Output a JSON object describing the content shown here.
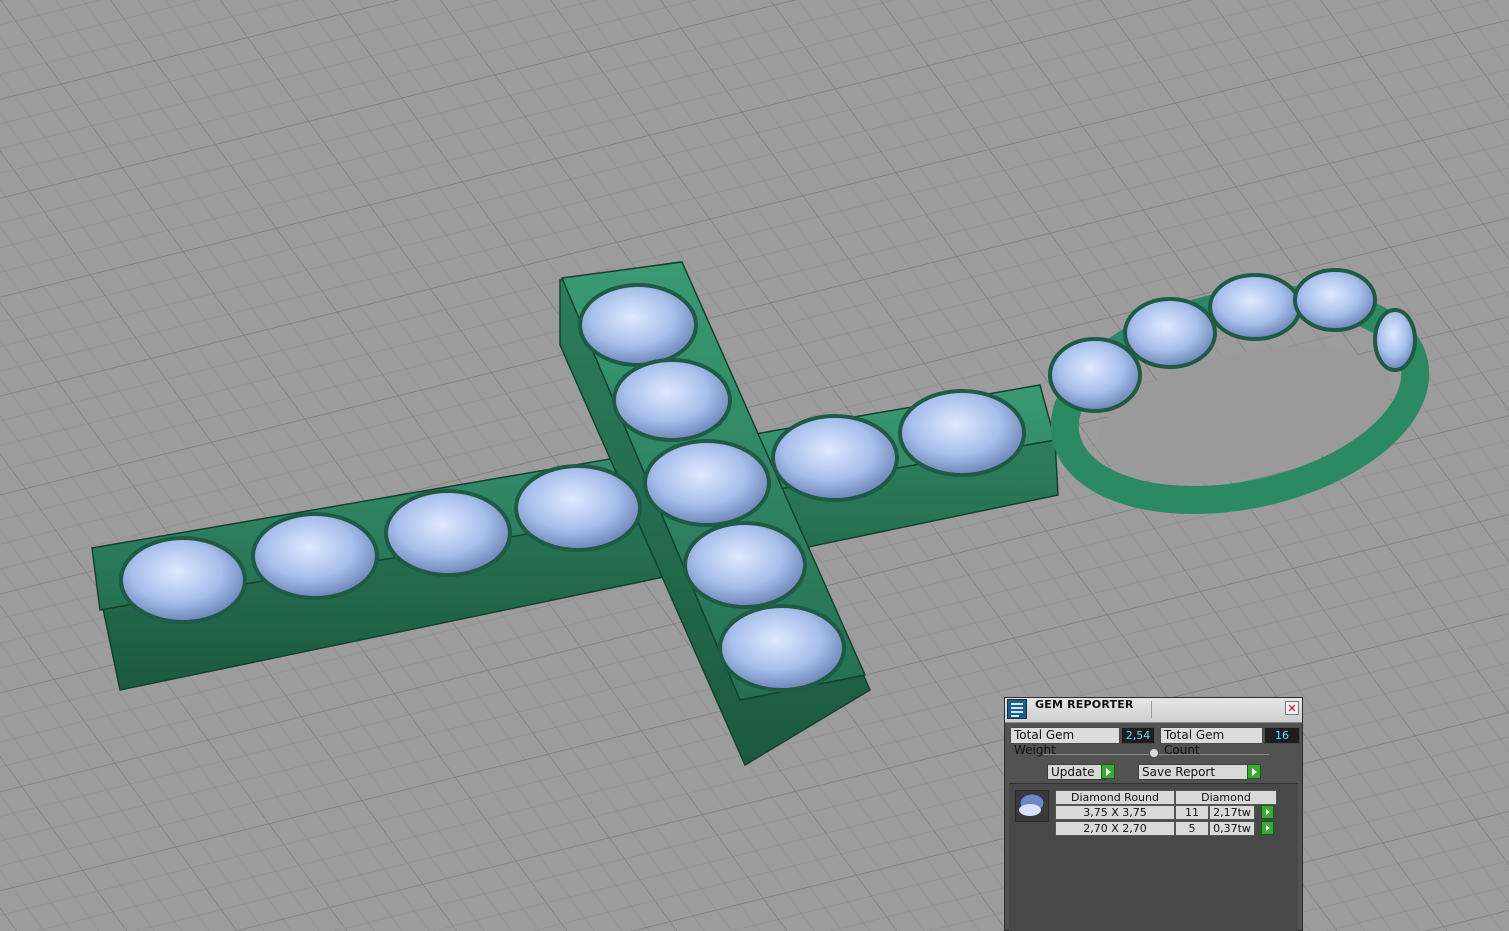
{
  "colors": {
    "metal": "#2f8a66",
    "gem": "#a9c2ee",
    "grid_bg": "#9a9a9a",
    "accent_value": "#74d4ff",
    "play_button": "#3aa834"
  },
  "panel": {
    "title": "GEM REPORTER",
    "close_icon": "close-icon",
    "total_weight_label": "Total Gem Weight",
    "total_weight_value": "2,54",
    "total_count_label": "Total Gem Count",
    "total_count_value": "16",
    "update_label": "Update",
    "save_report_label": "Save Report",
    "table": {
      "shape_header": "Diamond Round",
      "material_header": "Diamond",
      "rows": [
        {
          "size": "3,75 X 3,75",
          "count": "11",
          "weight": "2,17tw"
        },
        {
          "size": "2,70 X 2,70",
          "count": "5",
          "weight": "0,37tw"
        }
      ]
    }
  }
}
